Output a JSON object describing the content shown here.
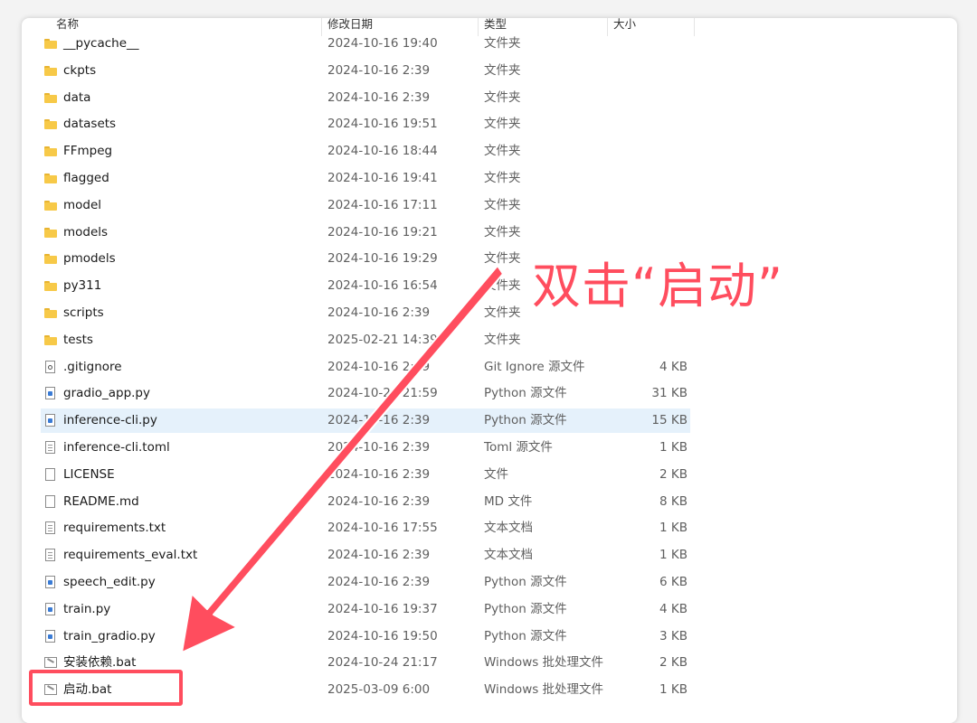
{
  "columns": {
    "name": "名称",
    "date": "修改日期",
    "type": "类型",
    "size": "大小"
  },
  "files": [
    {
      "name": "__pycache__",
      "date": "2024-10-16 19:40",
      "type": "文件夹",
      "size": "",
      "icon": "folder-icon"
    },
    {
      "name": "ckpts",
      "date": "2024-10-16 2:39",
      "type": "文件夹",
      "size": "",
      "icon": "folder-icon"
    },
    {
      "name": "data",
      "date": "2024-10-16 2:39",
      "type": "文件夹",
      "size": "",
      "icon": "folder-icon"
    },
    {
      "name": "datasets",
      "date": "2024-10-16 19:51",
      "type": "文件夹",
      "size": "",
      "icon": "folder-icon"
    },
    {
      "name": "FFmpeg",
      "date": "2024-10-16 18:44",
      "type": "文件夹",
      "size": "",
      "icon": "folder-icon"
    },
    {
      "name": "flagged",
      "date": "2024-10-16 19:41",
      "type": "文件夹",
      "size": "",
      "icon": "folder-icon"
    },
    {
      "name": "model",
      "date": "2024-10-16 17:11",
      "type": "文件夹",
      "size": "",
      "icon": "folder-icon"
    },
    {
      "name": "models",
      "date": "2024-10-16 19:21",
      "type": "文件夹",
      "size": "",
      "icon": "folder-icon"
    },
    {
      "name": "pmodels",
      "date": "2024-10-16 19:29",
      "type": "文件夹",
      "size": "",
      "icon": "folder-icon"
    },
    {
      "name": "py311",
      "date": "2024-10-16 16:54",
      "type": "文件夹",
      "size": "",
      "icon": "folder-icon"
    },
    {
      "name": "scripts",
      "date": "2024-10-16 2:39",
      "type": "文件夹",
      "size": "",
      "icon": "folder-icon"
    },
    {
      "name": "tests",
      "date": "2025-02-21 14:39",
      "type": "文件夹",
      "size": "",
      "icon": "folder-icon"
    },
    {
      "name": ".gitignore",
      "date": "2024-10-16 2:39",
      "type": "Git Ignore 源文件",
      "size": "4 KB",
      "icon": "gear-file-icon"
    },
    {
      "name": "gradio_app.py",
      "date": "2024-10-24 21:59",
      "type": "Python 源文件",
      "size": "31 KB",
      "icon": "python-file-icon"
    },
    {
      "name": "inference-cli.py",
      "date": "2024-10-16 2:39",
      "type": "Python 源文件",
      "size": "15 KB",
      "icon": "python-file-icon",
      "selected": true
    },
    {
      "name": "inference-cli.toml",
      "date": "2024-10-16 2:39",
      "type": "Toml 源文件",
      "size": "1 KB",
      "icon": "text-file-icon"
    },
    {
      "name": "LICENSE",
      "date": "2024-10-16 2:39",
      "type": "文件",
      "size": "2 KB",
      "icon": "blank-file-icon"
    },
    {
      "name": "README.md",
      "date": "2024-10-16 2:39",
      "type": "MD 文件",
      "size": "8 KB",
      "icon": "blank-file-icon"
    },
    {
      "name": "requirements.txt",
      "date": "2024-10-16 17:55",
      "type": "文本文档",
      "size": "1 KB",
      "icon": "text-file-icon"
    },
    {
      "name": "requirements_eval.txt",
      "date": "2024-10-16 2:39",
      "type": "文本文档",
      "size": "1 KB",
      "icon": "text-file-icon"
    },
    {
      "name": "speech_edit.py",
      "date": "2024-10-16 2:39",
      "type": "Python 源文件",
      "size": "6 KB",
      "icon": "python-file-icon"
    },
    {
      "name": "train.py",
      "date": "2024-10-16 19:37",
      "type": "Python 源文件",
      "size": "4 KB",
      "icon": "python-file-icon"
    },
    {
      "name": "train_gradio.py",
      "date": "2024-10-16 19:50",
      "type": "Python 源文件",
      "size": "3 KB",
      "icon": "python-file-icon"
    },
    {
      "name": "安装依赖.bat",
      "date": "2024-10-24 21:17",
      "type": "Windows 批处理文件",
      "size": "2 KB",
      "icon": "batch-file-icon"
    },
    {
      "name": "启动.bat",
      "date": "2025-03-09 6:00",
      "type": "Windows 批处理文件",
      "size": "1 KB",
      "icon": "batch-file-icon"
    }
  ],
  "annotation": {
    "text": "双击“启动”",
    "color": "#ff4d5e"
  },
  "colors": {
    "selection": "#e5f1fb",
    "folder": "#f7c948",
    "accent": "#ff4d5e"
  }
}
